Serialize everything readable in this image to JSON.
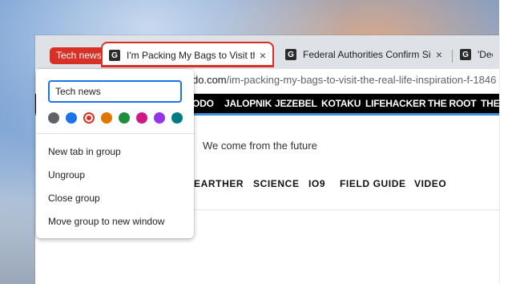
{
  "tabstrip": {
    "group_label": "Tech news",
    "tabs": [
      {
        "favicon": "G",
        "title": "I'm Packing My Bags to Visit the",
        "close": "×"
      },
      {
        "favicon": "G",
        "title": "Federal Authorities Confirm Sigh",
        "close": "×"
      },
      {
        "favicon": "G",
        "title": "'Deep",
        "close": ""
      }
    ]
  },
  "toolbar": {
    "url_host": "do.com",
    "url_path": "/im-packing-my-bags-to-visit-the-real-life-inspiration-f-1846"
  },
  "site": {
    "network_links": [
      "ODO",
      "JALOPNIK",
      "JEZEBEL",
      "KOTAKU",
      "LIFEHACKER",
      "THE ROOT",
      "THE"
    ],
    "tagline": "We come from the future",
    "section_links": [
      "EARTHER",
      "SCIENCE",
      "IO9",
      "FIELD GUIDE",
      "VIDEO"
    ],
    "accent_color": "#3a8fd8"
  },
  "group_editor": {
    "name_value": "Tech news",
    "colors": [
      {
        "name": "grey",
        "hex": "#5f6368"
      },
      {
        "name": "blue",
        "hex": "#1a73e8"
      },
      {
        "name": "red",
        "hex": "#d93025",
        "selected": true
      },
      {
        "name": "yellow",
        "hex": "#e37400"
      },
      {
        "name": "green",
        "hex": "#1e8e3e"
      },
      {
        "name": "pink",
        "hex": "#d01884"
      },
      {
        "name": "purple",
        "hex": "#9334e6"
      },
      {
        "name": "cyan",
        "hex": "#007b83"
      }
    ],
    "menu": [
      "New tab in group",
      "Ungroup",
      "Close group",
      "Move group to new window"
    ]
  }
}
